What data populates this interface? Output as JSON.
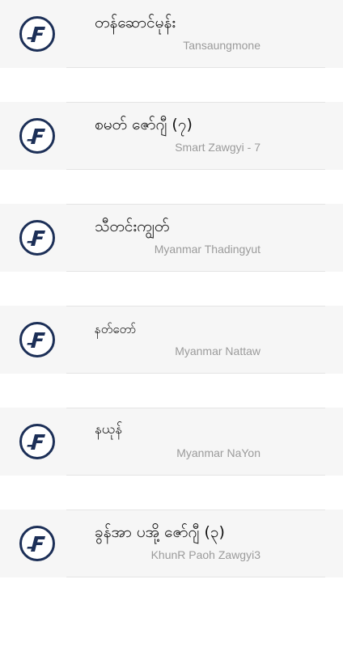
{
  "font_list": {
    "items": [
      {
        "title": "တန်ဆောင်မုန်း",
        "subtitle": "Tansaungmone",
        "icon": "f-logo-icon"
      },
      {
        "title": "စမတ် ဇော်ဂျီ (၇)",
        "subtitle": "Smart Zawgyi - 7",
        "icon": "f-logo-icon"
      },
      {
        "title": "သီတင်းကျွတ်",
        "subtitle": "Myanmar Thadingyut",
        "icon": "f-logo-icon"
      },
      {
        "title": "နတ်တော်",
        "subtitle": "Myanmar Nattaw",
        "icon": "f-logo-icon"
      },
      {
        "title": "နယုန်",
        "subtitle": "Myanmar NaYon",
        "icon": "f-logo-icon"
      },
      {
        "title": "ခွန်အာ ပအို့ ဇော်ဂျီ (၃)",
        "subtitle": "KhunR Paoh Zawgyi3",
        "icon": "f-logo-icon"
      }
    ]
  },
  "colors": {
    "logo_ring": "#1c2f57",
    "logo_letter": "#1c2f57",
    "title_text": "#111111",
    "subtitle_text": "#9b9b9b",
    "row_background": "#f6f6f6",
    "divider": "#e4e4e4"
  }
}
